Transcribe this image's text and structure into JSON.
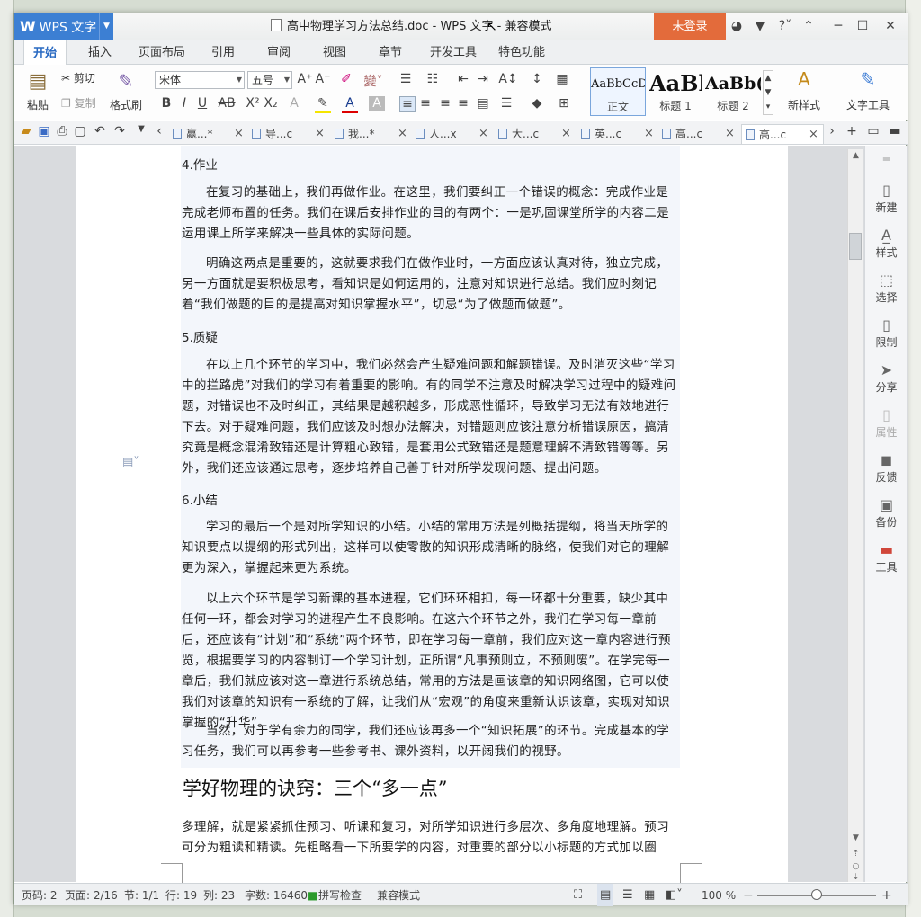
{
  "app": {
    "name": "WPS 文字",
    "title": "高中物理学习方法总结.doc - WPS 文字 - 兼容模式",
    "login_label": "未登录"
  },
  "ribbon_tabs": [
    "开始",
    "插入",
    "页面布局",
    "引用",
    "审阅",
    "视图",
    "章节",
    "开发工具",
    "特色功能"
  ],
  "ribbon": {
    "paste": "粘贴",
    "cut": "剪切",
    "copy": "复制",
    "format_painter": "格式刷",
    "font_name": "宋体",
    "font_size": "五号",
    "styles": [
      {
        "preview": "AaBbCcD",
        "label": "正文"
      },
      {
        "preview": "AaBl",
        "label": "标题 1"
      },
      {
        "preview": "AaBb(",
        "label": "标题 2"
      }
    ],
    "new_style": "新样式",
    "text_tools": "文字工具"
  },
  "doc_tabs": [
    "赢...*",
    "导...c",
    "我...*",
    "人...x",
    "大...c",
    "英...c",
    "高...c",
    "高...c"
  ],
  "document": {
    "h4": "4.作业",
    "p4a": "在复习的基础上，我们再做作业。在这里，我们要纠正一个错误的概念：完成作业是完成老师布置的任务。我们在课后安排作业的目的有两个：一是巩固课堂所学的内容二是运用课上所学来解决一些具体的实际问题。",
    "p4b": "明确这两点是重要的，这就要求我们在做作业时，一方面应该认真对待，独立完成，另一方面就是要积极思考，看知识是如何运用的，注意对知识进行总结。我们应时刻记着“我们做题的目的是提高对知识掌握水平”，切忌“为了做题而做题”。",
    "h5": "5.质疑",
    "p5": "在以上几个环节的学习中，我们必然会产生疑难问题和解题错误。及时消灭这些“学习中的拦路虎”对我们的学习有着重要的影响。有的同学不注意及时解决学习过程中的疑难问题，对错误也不及时纠正，其结果是越积越多，形成恶性循环，导致学习无法有效地进行下去。对于疑难问题，我们应该及时想办法解决，对错题则应该注意分析错误原因，搞清究竟是概念混淆致错还是计算粗心致错，是套用公式致错还是题意理解不清致错等等。另外，我们还应该通过思考，逐步培养自己善于针对所学发现问题、提出问题。",
    "h6": "6.小结",
    "p6a": "学习的最后一个是对所学知识的小结。小结的常用方法是列概括提纲，将当天所学的知识要点以提纲的形式列出，这样可以使零散的知识形成清晰的脉络，使我们对它的理解更为深入，掌握起来更为系统。",
    "p6b": "以上六个环节是学习新课的基本进程，它们环环相扣，每一环都十分重要，缺少其中任何一环，都会对学习的进程产生不良影响。在这六个环节之外，我们在学习每一章前后，还应该有“计划”和“系统”两个环节，即在学习每一章前，我们应对这一章内容进行预览，根据要学习的内容制订一个学习计划，正所谓“凡事预则立，不预则废”。在学完每一章后，我们就应该对这一章进行系统总结，常用的方法是画该章的知识网络图，它可以使我们对该章的知识有一系统的了解，让我们从“宏观”的角度来重新认识该章，实现对知识掌握的“升华”。",
    "p6c": "当然，对于学有余力的同学，我们还应该再多一个“知识拓展”的环节。完成基本的学习任务，我们可以再参考一些参考书、课外资料，以开阔我们的视野。",
    "heading_big": "学好物理的诀窍：三个“多一点”",
    "p7": "多理解，就是紧紧抓住预习、听课和复习，对所学知识进行多层次、多角度地理解。预习可分为粗读和精读。先粗略看一下所要学的内容，对重要的部分以小标题的方式加以圈注。接"
  },
  "side_panel": [
    "新建",
    "样式",
    "选择",
    "限制",
    "分享",
    "属性",
    "反馈",
    "备份",
    "工具"
  ],
  "status": {
    "page_code": "页码: 2",
    "pages": "页面: 2/16",
    "section": "节: 1/1",
    "row": "行: 19",
    "col": "列: 23",
    "words": "字数: 16460",
    "spell": "拼写检查",
    "compat": "兼容模式",
    "zoom": "100 %"
  },
  "zoom_level": 100
}
